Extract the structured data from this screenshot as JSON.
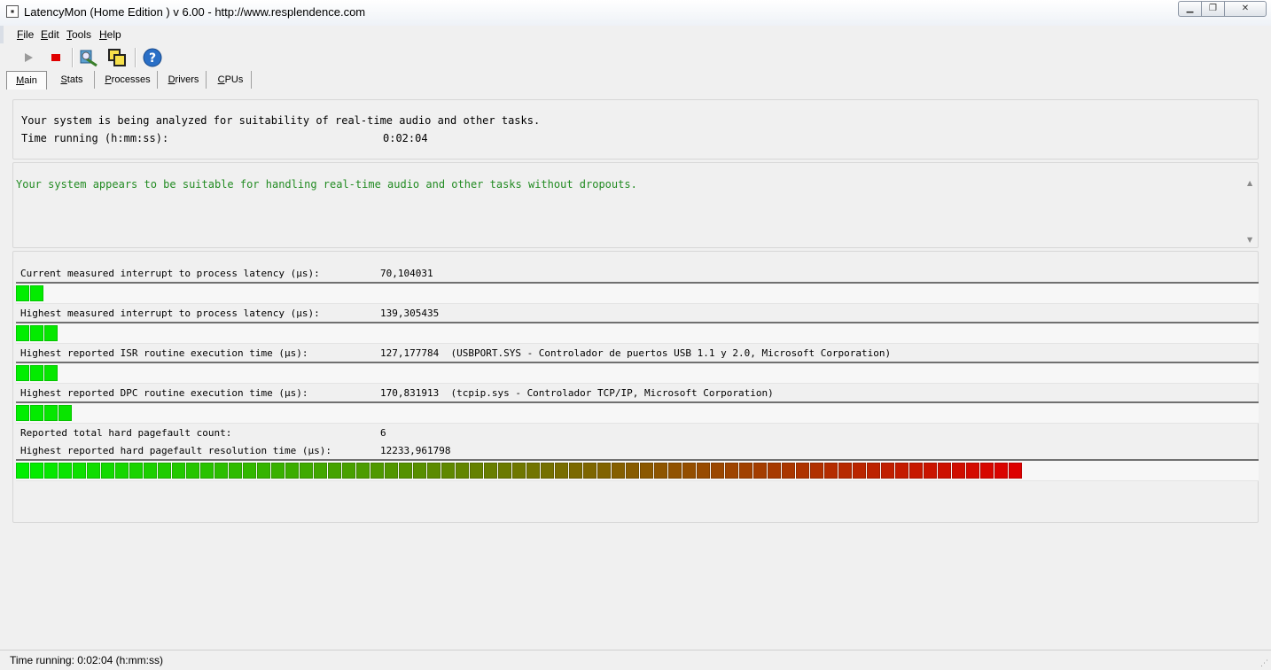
{
  "window": {
    "title": "LatencyMon  (Home Edition )  v 6.00 - http://www.resplendence.com",
    "app_icon": "latencymon-icon",
    "controls": {
      "minimize": "▁",
      "maximize": "❐",
      "close": "✕"
    }
  },
  "menu": [
    {
      "accel": "F",
      "rest": "ile"
    },
    {
      "accel": "E",
      "rest": "dit"
    },
    {
      "accel": "T",
      "rest": "ools"
    },
    {
      "accel": "H",
      "rest": "elp"
    }
  ],
  "toolbar": {
    "play_icon": "play-icon",
    "stop_icon": "stop-icon",
    "tool_icon": "magnify-tool-icon",
    "window_icon": "windows-icon",
    "help_icon": "help-icon"
  },
  "tabs": [
    {
      "accel": "M",
      "rest": "ain"
    },
    {
      "accel": "S",
      "rest": "tats"
    },
    {
      "accel": "P",
      "rest": "rocesses"
    },
    {
      "accel": "D",
      "rest": "rivers"
    },
    {
      "accel": "C",
      "rest": "PUs"
    }
  ],
  "summary": {
    "line1": "Your system is being analyzed for suitability of real-time audio and other tasks.",
    "time_label": "Time running (h:mm:ss):",
    "time_value": "0:02:04"
  },
  "verdict": {
    "text": "Your system appears to be suitable for handling real-time audio and other tasks without dropouts.",
    "color": "#228b22"
  },
  "metrics": {
    "current_latency": {
      "label": "Current measured interrupt to process latency (µs):",
      "value": "70,104031",
      "bar_segments": 2
    },
    "highest_latency": {
      "label": "Highest measured interrupt to process latency (µs):",
      "value": "139,305435",
      "bar_segments": 3
    },
    "isr": {
      "label": "Highest reported ISR routine execution time (µs):",
      "value": "127,177784  (USBPORT.SYS - Controlador de puertos USB 1.1 y 2.0, Microsoft Corporation)",
      "bar_segments": 3
    },
    "dpc": {
      "label": "Highest reported DPC routine execution time (µs):",
      "value": "170,831913  (tcpip.sys - Controlador TCP/IP, Microsoft Corporation)",
      "bar_segments": 4
    },
    "pagefault_count": {
      "label": "Reported total hard pagefault count:",
      "value": "6"
    },
    "pagefault_time": {
      "label": "Highest reported hard pagefault resolution time (µs):",
      "value": "12233,961798",
      "bar_segments": 71
    }
  },
  "meter_colors": {
    "start": "#00ee00",
    "end": "#dd0000"
  },
  "status": {
    "text": "Time running: 0:02:04  (h:mm:ss)"
  }
}
